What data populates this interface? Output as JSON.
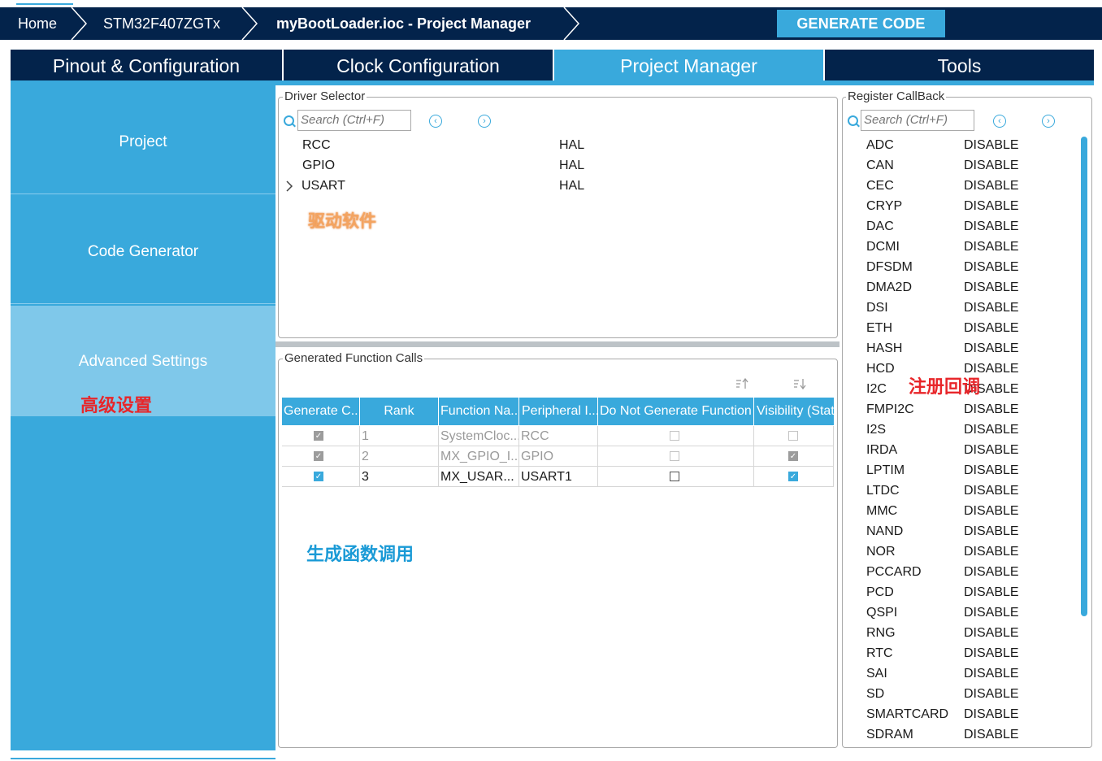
{
  "breadcrumb": {
    "items": [
      "Home",
      "STM32F407ZGTx",
      "myBootLoader.ioc - Project Manager"
    ],
    "generate_label": "GENERATE CODE"
  },
  "tabs": [
    "Pinout & Configuration",
    "Clock Configuration",
    "Project Manager",
    "Tools"
  ],
  "active_tab": "Project Manager",
  "sidebar": {
    "items": [
      "Project",
      "Code Generator",
      "Advanced Settings"
    ],
    "selected": "Advanced Settings"
  },
  "driver_selector": {
    "title": "Driver Selector",
    "search_placeholder": "Search (Ctrl+F)",
    "rows": [
      {
        "name": "RCC",
        "value": "HAL"
      },
      {
        "name": "GPIO",
        "value": "HAL"
      },
      {
        "name": "USART",
        "value": "HAL"
      }
    ]
  },
  "function_calls": {
    "title": "Generated Function Calls",
    "headers": [
      "Generate C...",
      "Rank",
      "Function Na...",
      "Peripheral I...",
      "Do Not Generate Function C",
      "Visibility (Stat"
    ],
    "rows": [
      {
        "generate": true,
        "rank": "1",
        "function": "SystemCloc...",
        "peripheral": "RCC",
        "do_not_generate": false,
        "visibility": false,
        "enabled": false
      },
      {
        "generate": true,
        "rank": "2",
        "function": "MX_GPIO_I...",
        "peripheral": "GPIO",
        "do_not_generate": false,
        "visibility": true,
        "enabled": false
      },
      {
        "generate": true,
        "rank": "3",
        "function": "MX_USAR...",
        "peripheral": "USART1",
        "do_not_generate": false,
        "visibility": true,
        "enabled": true
      }
    ]
  },
  "register_callback": {
    "title": "Register CallBack",
    "search_placeholder": "Search (Ctrl+F)",
    "rows": [
      {
        "name": "ADC",
        "value": "DISABLE"
      },
      {
        "name": "CAN",
        "value": "DISABLE"
      },
      {
        "name": "CEC",
        "value": "DISABLE"
      },
      {
        "name": "CRYP",
        "value": "DISABLE"
      },
      {
        "name": "DAC",
        "value": "DISABLE"
      },
      {
        "name": "DCMI",
        "value": "DISABLE"
      },
      {
        "name": "DFSDM",
        "value": "DISABLE"
      },
      {
        "name": "DMA2D",
        "value": "DISABLE"
      },
      {
        "name": "DSI",
        "value": "DISABLE"
      },
      {
        "name": "ETH",
        "value": "DISABLE"
      },
      {
        "name": "HASH",
        "value": "DISABLE"
      },
      {
        "name": "HCD",
        "value": "DISABLE"
      },
      {
        "name": "I2C",
        "value": "DISABLE"
      },
      {
        "name": "FMPI2C",
        "value": "DISABLE"
      },
      {
        "name": "I2S",
        "value": "DISABLE"
      },
      {
        "name": "IRDA",
        "value": "DISABLE"
      },
      {
        "name": "LPTIM",
        "value": "DISABLE"
      },
      {
        "name": "LTDC",
        "value": "DISABLE"
      },
      {
        "name": "MMC",
        "value": "DISABLE"
      },
      {
        "name": "NAND",
        "value": "DISABLE"
      },
      {
        "name": "NOR",
        "value": "DISABLE"
      },
      {
        "name": "PCCARD",
        "value": "DISABLE"
      },
      {
        "name": "PCD",
        "value": "DISABLE"
      },
      {
        "name": "QSPI",
        "value": "DISABLE"
      },
      {
        "name": "RNG",
        "value": "DISABLE"
      },
      {
        "name": "RTC",
        "value": "DISABLE"
      },
      {
        "name": "SAI",
        "value": "DISABLE"
      },
      {
        "name": "SD",
        "value": "DISABLE"
      },
      {
        "name": "SMARTCARD",
        "value": "DISABLE"
      },
      {
        "name": "SDRAM",
        "value": "DISABLE"
      }
    ]
  },
  "annotations": {
    "driver": "驱动软件",
    "advanced": "高级设置",
    "callback": "注册回调",
    "functions": "生成函数调用"
  },
  "colors": {
    "navy": "#03234b",
    "accent": "#39a9dc",
    "selected": "#7fc8ea",
    "annotation_red": "#e8262a",
    "annotation_blue": "#1a9ad6",
    "annotation_orange": "#f4a460"
  }
}
